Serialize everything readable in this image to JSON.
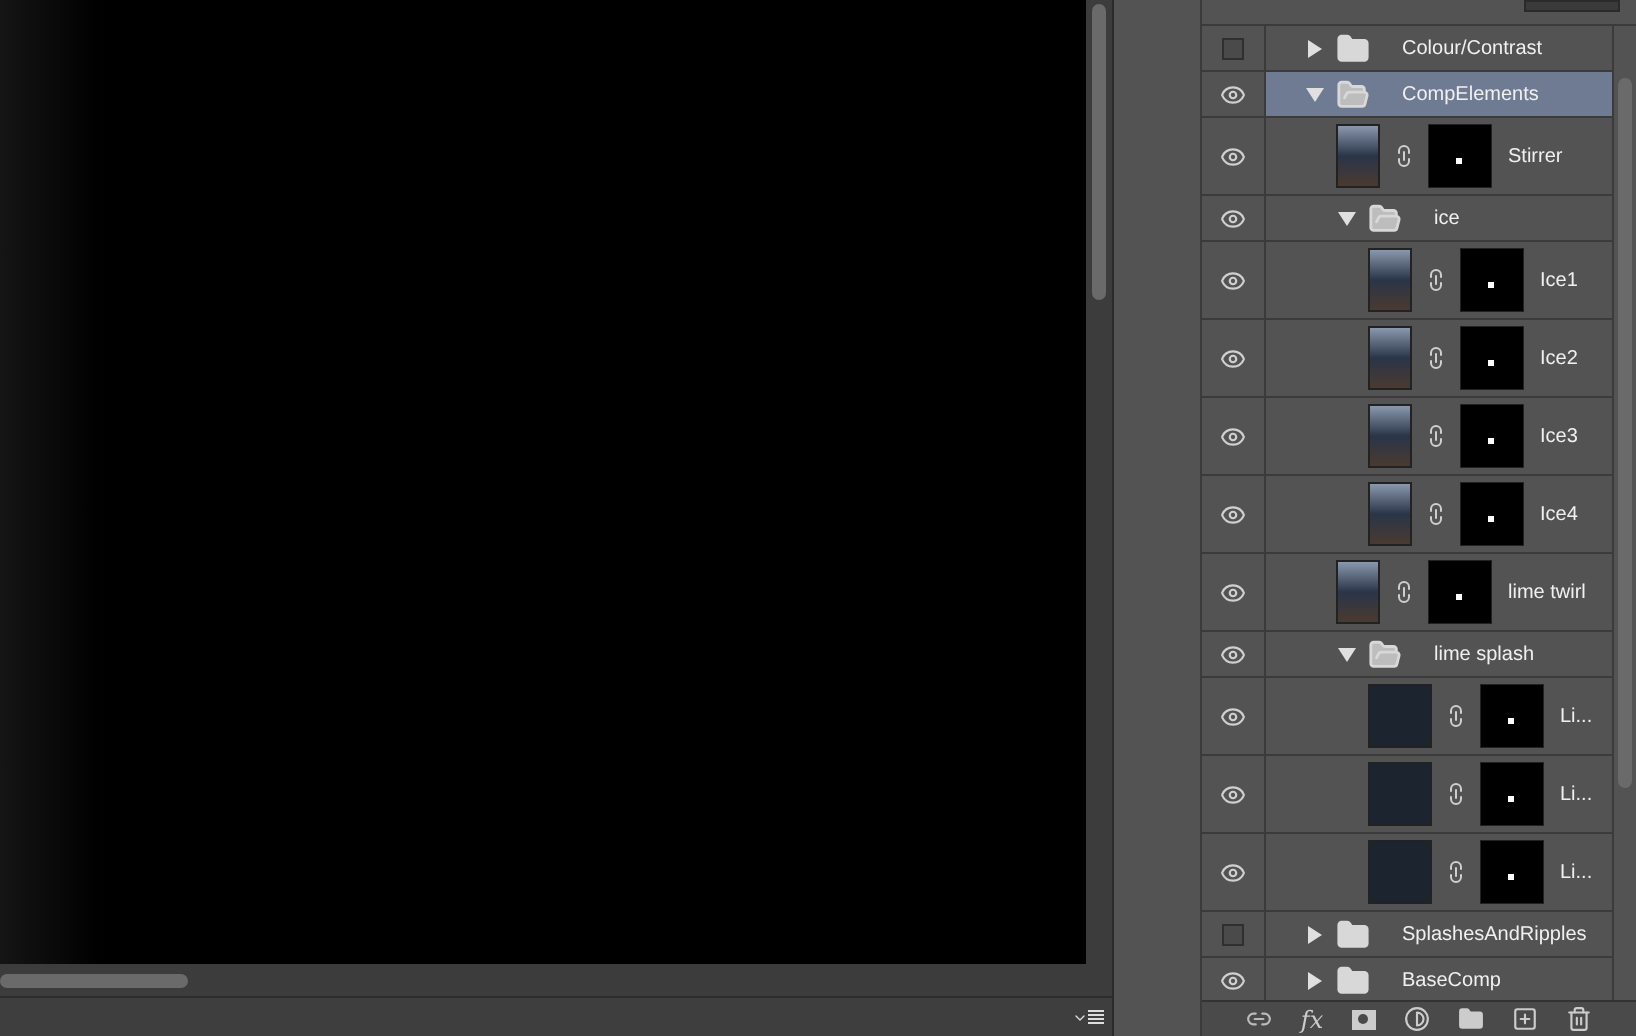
{
  "layers": [
    {
      "kind": "group",
      "name": "Colour/Contrast",
      "visible": false,
      "expanded": false,
      "selected": false
    },
    {
      "kind": "group",
      "name": "CompElements",
      "visible": true,
      "expanded": true,
      "selected": true,
      "children": [
        {
          "kind": "layer",
          "name": "Stirrer",
          "visible": true,
          "selected": false,
          "square_thumb": false
        },
        {
          "kind": "group",
          "name": "ice",
          "visible": true,
          "expanded": true,
          "selected": false,
          "children": [
            {
              "kind": "layer",
              "name": "Ice1",
              "visible": true,
              "selected": false,
              "square_thumb": false
            },
            {
              "kind": "layer",
              "name": "Ice2",
              "visible": true,
              "selected": false,
              "square_thumb": false
            },
            {
              "kind": "layer",
              "name": "Ice3",
              "visible": true,
              "selected": false,
              "square_thumb": false
            },
            {
              "kind": "layer",
              "name": "Ice4",
              "visible": true,
              "selected": false,
              "square_thumb": false
            }
          ]
        },
        {
          "kind": "layer",
          "name": "lime twirl",
          "visible": true,
          "selected": false,
          "square_thumb": false
        },
        {
          "kind": "group",
          "name": "lime splash",
          "visible": true,
          "expanded": true,
          "selected": false,
          "children": [
            {
              "kind": "layer",
              "name": "Li...",
              "visible": true,
              "selected": false,
              "square_thumb": true
            },
            {
              "kind": "layer",
              "name": "Li...",
              "visible": true,
              "selected": false,
              "square_thumb": true
            },
            {
              "kind": "layer",
              "name": "Li...",
              "visible": true,
              "selected": false,
              "square_thumb": true
            }
          ]
        }
      ]
    },
    {
      "kind": "group",
      "name": "SplashesAndRipples",
      "visible": false,
      "expanded": false,
      "selected": false
    },
    {
      "kind": "group",
      "name": "BaseComp",
      "visible": true,
      "expanded": false,
      "selected": false
    }
  ],
  "toolbar": {
    "fx_label": "fx"
  }
}
